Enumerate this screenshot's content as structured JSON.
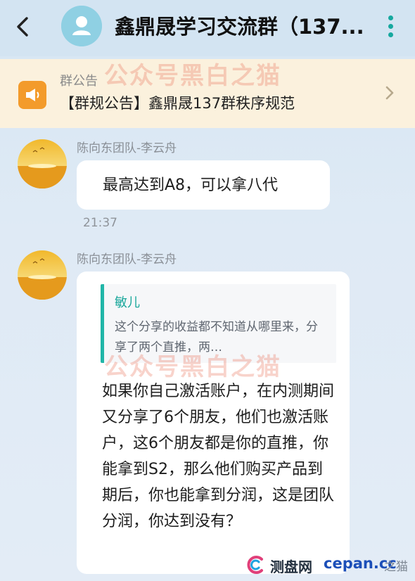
{
  "header": {
    "title": "鑫鼎晟学习交流群（137..."
  },
  "notice": {
    "heading": "群公告",
    "text": "【群规公告】鑫鼎晟137群秩序规范"
  },
  "messages": [
    {
      "sender": "陈向东团队-李云舟",
      "text": "最高达到A8，可以拿八代",
      "time": "21:37"
    },
    {
      "sender": "陈向东团队-李云舟",
      "quote_name": "敏儿",
      "quote_text": "这个分享的收益都不知道从哪里来，分享了两个直推，两…",
      "text": "如果你自己激活账户，在内测期间又分享了6个朋友，他们也激活账户，这6个朋友都是你的直推，你能拿到S2，那么他们购买产品到期后，你也能拿到分润，这是团队分润，你达到没有？"
    }
  ],
  "watermark": {
    "text": "公众号黑白之猫"
  },
  "badge": {
    "logo_text": "测盘网",
    "url": "cepan.cc",
    "tail": "之猫"
  },
  "colors": {
    "accent": "#16a89f",
    "notice_bg": "#fbf1dd",
    "notice_icon": "#f39b2b",
    "bubble": "#ffffff"
  }
}
